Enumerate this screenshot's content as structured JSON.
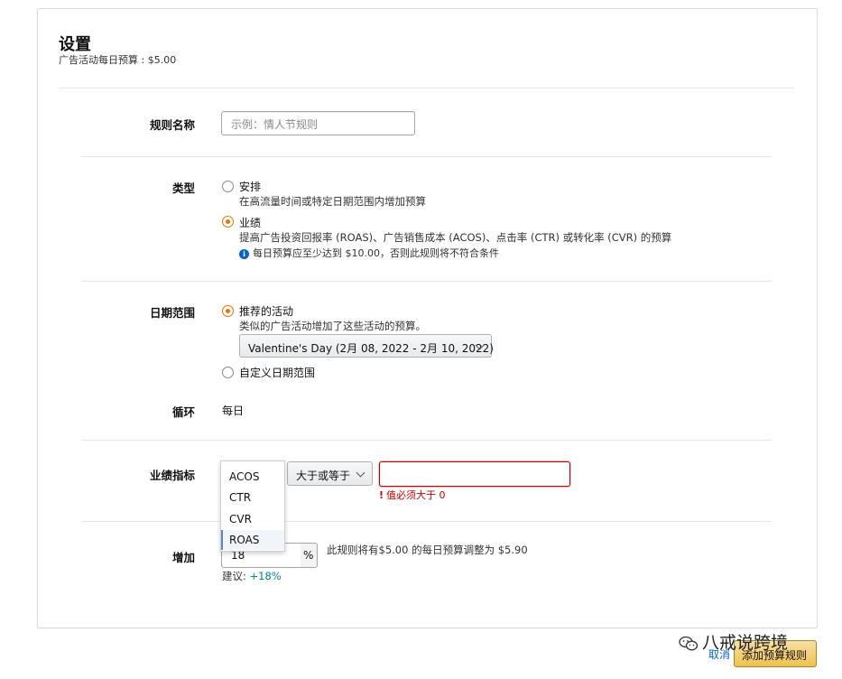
{
  "header": {
    "title": "设置",
    "subtitle": "广告活动每日预算 : $5.00"
  },
  "rule_name": {
    "label": "规则名称",
    "placeholder": "示例：情人节规则",
    "value": ""
  },
  "type": {
    "label": "类型",
    "options": [
      {
        "label": "安排",
        "description": "在高流量时间或特定日期范围内增加预算",
        "selected": false
      },
      {
        "label": "业绩",
        "description": "提高广告投资回报率 (ROAS)、广告销售成本 (ACOS)、点击率 (CTR) 或转化率 (CVR) 的预算",
        "selected": true
      }
    ],
    "info": "每日预算应至少达到 $10.00，否则此规则将不符合条件"
  },
  "date_range": {
    "label": "日期范围",
    "recommended_label": "推荐的活动",
    "recommended_desc": "类似的广告活动增加了这些活动的预算。",
    "event_select": "Valentine's Day (2月 08, 2022 - 2月 10, 2022)",
    "custom_label": "自定义日期范围",
    "selected": "recommended"
  },
  "recurrence": {
    "label": "循环",
    "value": "每日"
  },
  "metric": {
    "label": "业绩指标",
    "options": [
      "ACOS",
      "CTR",
      "CVR",
      "ROAS"
    ],
    "highlighted": "ROAS",
    "comparator": "大于或等于",
    "value": "",
    "error": "值必须大于 0"
  },
  "increase": {
    "label": "增加",
    "value": "18",
    "unit": "%",
    "summary": "此规则将有$5.00 的每日预算调整为 $5.90",
    "suggestion_label": "建议:",
    "suggestion_value": "+18%"
  },
  "footer": {
    "cancel": "取消",
    "submit": "添加预算规则"
  },
  "watermark": "八戒说跨境",
  "colors": {
    "accent_orange": "#e77600",
    "error_red": "#c40000",
    "link_blue": "#0066c0",
    "suggestion_teal": "#008296",
    "primary_button": "#f0c14b"
  }
}
